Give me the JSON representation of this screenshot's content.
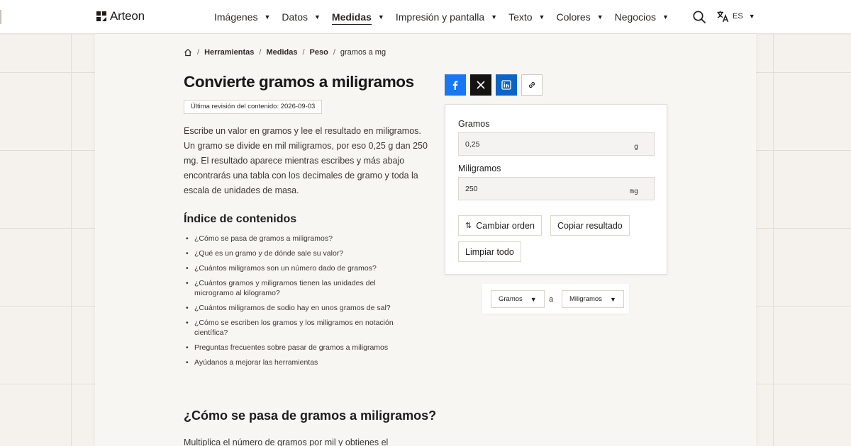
{
  "header": {
    "brand": "Arteon",
    "nav": [
      {
        "label": "Imágenes",
        "active": false
      },
      {
        "label": "Datos",
        "active": false
      },
      {
        "label": "Medidas",
        "active": true
      },
      {
        "label": "Impresión y pantalla",
        "active": false
      },
      {
        "label": "Texto",
        "active": false
      },
      {
        "label": "Colores",
        "active": false
      },
      {
        "label": "Negocios",
        "active": false
      }
    ],
    "caret": "▼",
    "language": "ES"
  },
  "breadcrumb": {
    "items": [
      "Herramientas",
      "Medidas",
      "Peso"
    ],
    "current": "gramos a mg",
    "separator": "/"
  },
  "article": {
    "title": "Convierte gramos a miligramos",
    "revised": "Última revisión del contenido: 2026-09-03",
    "intro": "Escribe un valor en gramos y lee el resultado en miligramos. Un gramo se divide en mil miligramos, por eso 0,25 g dan 250 mg. El resultado aparece mientras escribes y más abajo encontrarás una tabla con los decimales de gramo y toda la escala de unidades de masa.",
    "toc_title": "Índice de contenidos",
    "toc": [
      "¿Cómo se pasa de gramos a miligramos?",
      "¿Qué es un gramo y de dónde sale su valor?",
      "¿Cuántos miligramos son un número dado de gramos?",
      "¿Cuántos gramos y miligramos tienen las unidades del microgramo al kilogramo?",
      "¿Cuántos miligramos de sodio hay en unos gramos de sal?",
      "¿Cómo se escriben los gramos y los miligramos en notación científica?",
      "Preguntas frecuentes sobre pasar de gramos a miligramos",
      "Ayúdanos a mejorar las herramientas"
    ],
    "section_heading": "¿Cómo se pasa de gramos a miligramos?",
    "section_text": "Multiplica el número de gramos por mil y obtienes el"
  },
  "converter": {
    "from": {
      "label": "Gramos",
      "value": "0,25",
      "unit": "g"
    },
    "to": {
      "label": "Miligramos",
      "value": "250",
      "unit": "mg"
    },
    "swap_icon": "⇅",
    "swap_label": "Cambiar orden",
    "copy_label": "Copiar resultado",
    "clear_label": "Limpiar todo"
  },
  "unit_select": {
    "from": "Gramos",
    "connector": "a",
    "to": "Miligramos"
  },
  "colors": {
    "facebook": "#1877f2",
    "x": "#141312",
    "linkedin": "#0a66c2",
    "background": "#f5f2ee"
  }
}
